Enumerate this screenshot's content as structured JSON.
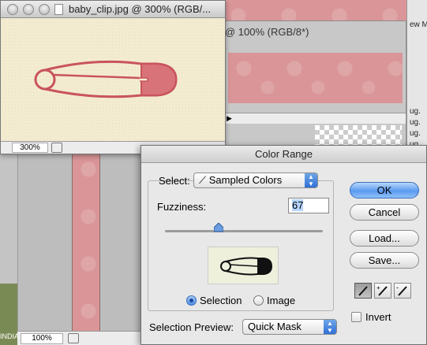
{
  "background": {
    "right_strip_texts": [
      "ew M",
      "ug.",
      "ug.",
      "ug.",
      "ug."
    ],
    "doc2_title": "@ 100% (RGB/8*)",
    "doc3_zoom": "100%",
    "left_edge_label": "INDIA"
  },
  "doc1": {
    "title": "baby_clip.jpg @ 300% (RGB/...",
    "zoom": "300%"
  },
  "dialog": {
    "title": "Color Range",
    "select_label": "Select:",
    "select_value": "Sampled Colors",
    "fuzziness_label": "Fuzziness:",
    "fuzziness_value": "67",
    "fuzziness_slider_fraction": 0.34,
    "radio_selection": "Selection",
    "radio_image": "Image",
    "selected_radio": "Selection",
    "preview_label": "Selection Preview:",
    "preview_value": "Quick Mask",
    "buttons": {
      "ok": "OK",
      "cancel": "Cancel",
      "load": "Load...",
      "save": "Save..."
    },
    "invert_label": "Invert",
    "invert_checked": false
  },
  "colors": {
    "accent_blue": "#5b9af0",
    "clip_red": "#c9545c",
    "pink_bg": "#d99597",
    "canvas": "#f3ecd1"
  }
}
